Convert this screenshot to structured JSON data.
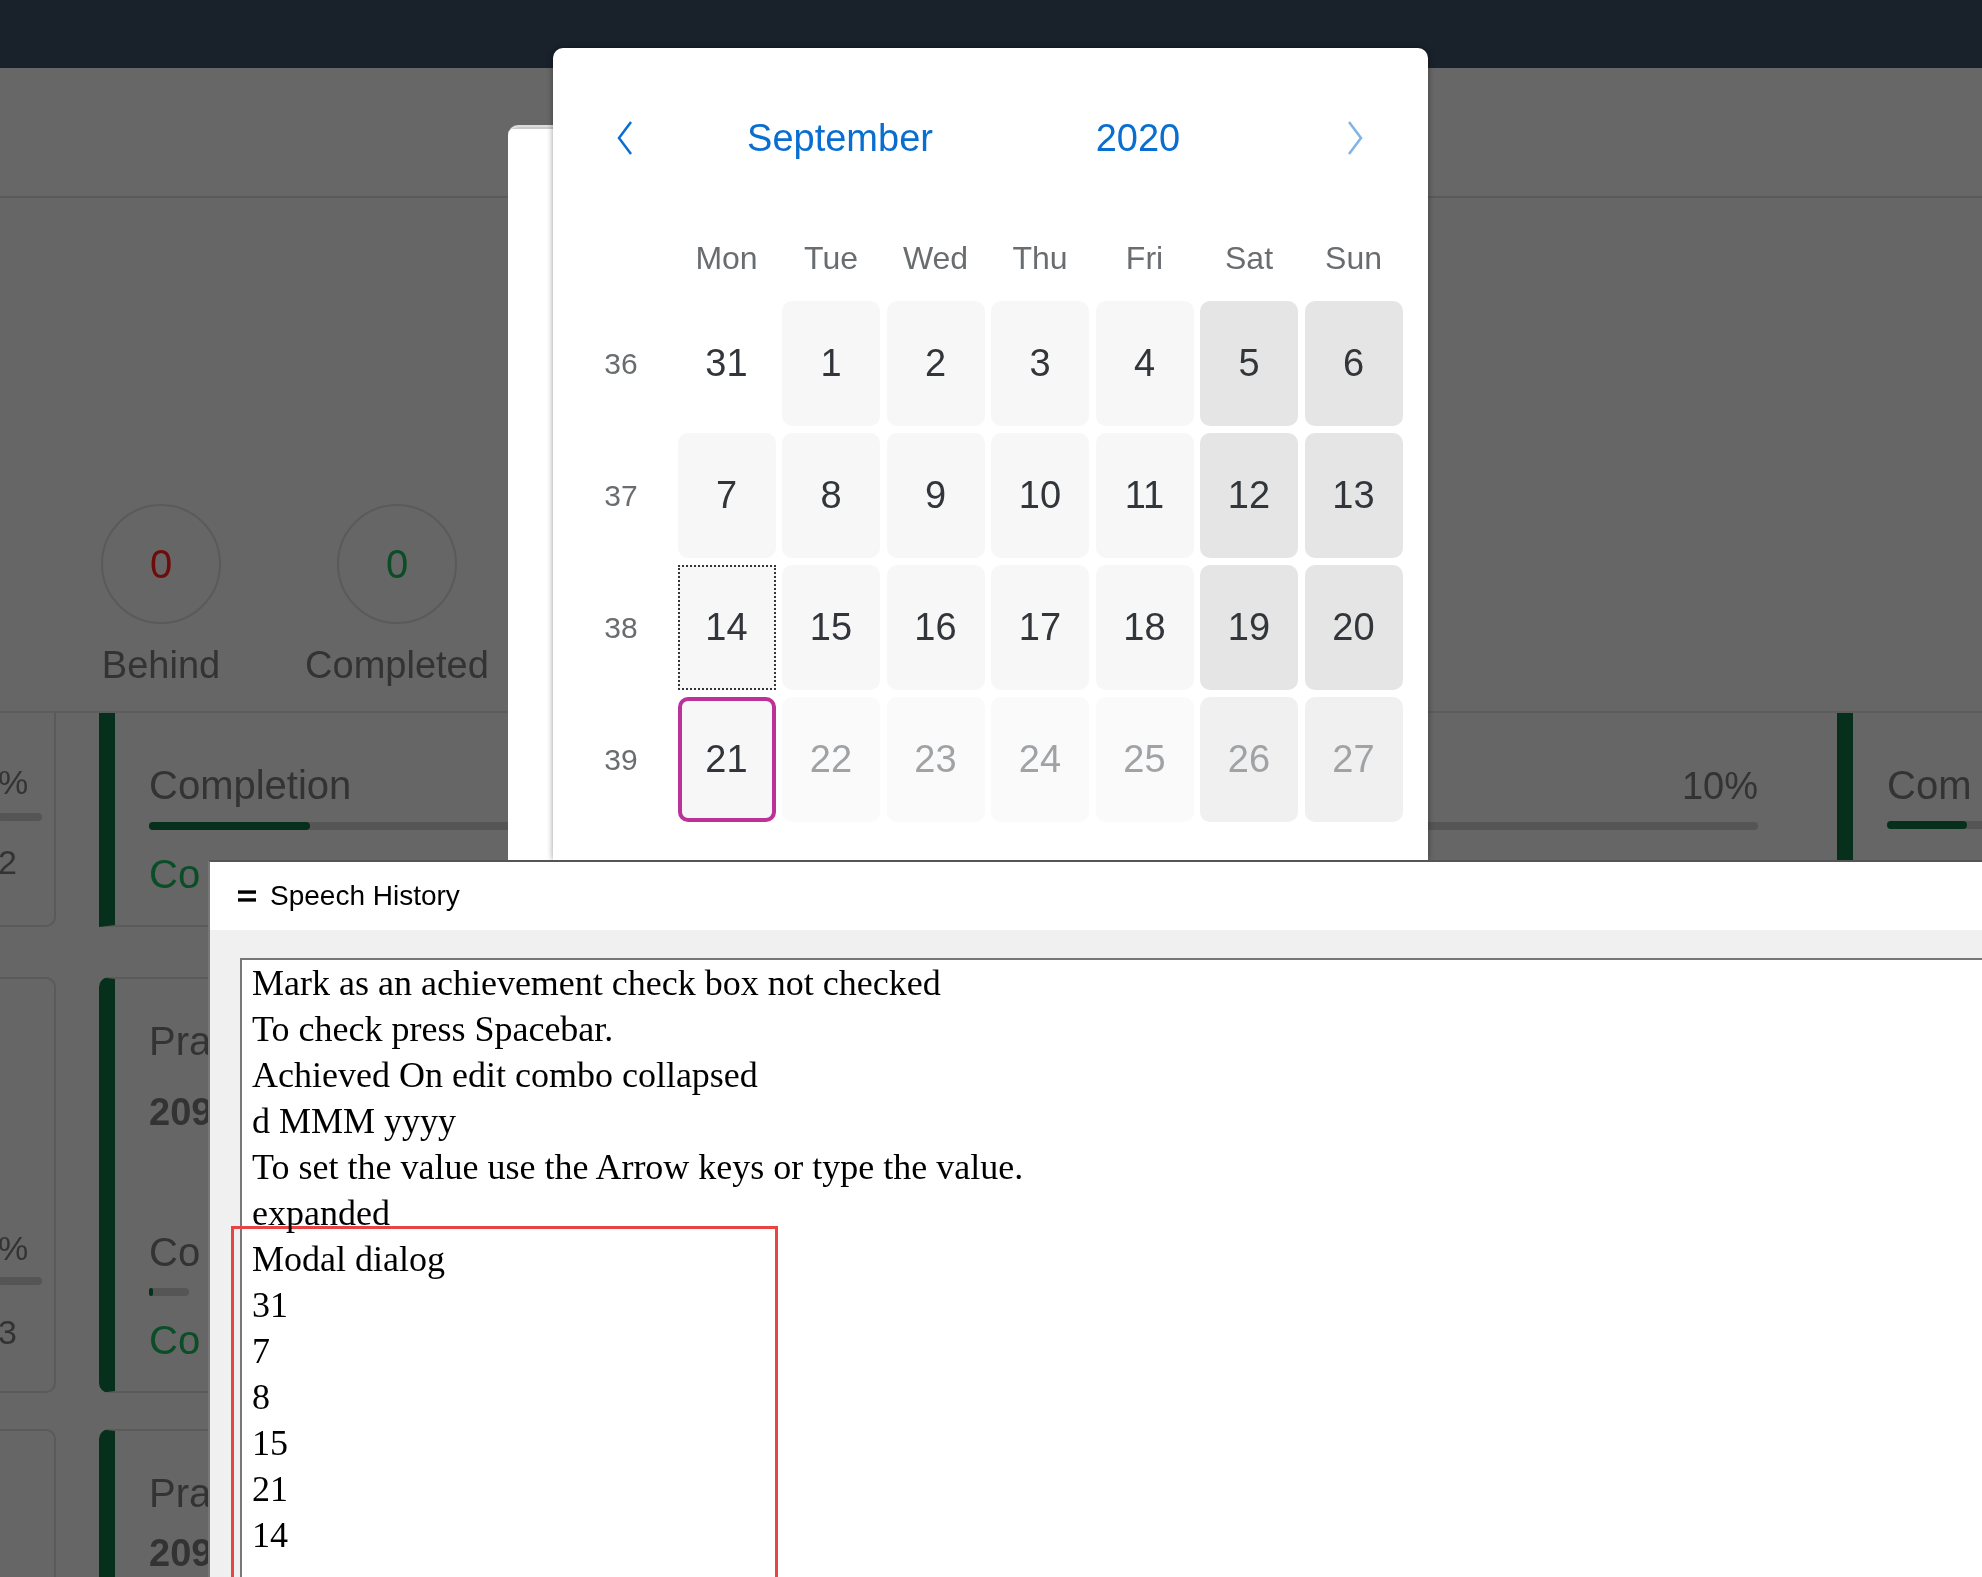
{
  "counters": [
    {
      "value": "0",
      "label": "Behind",
      "color": "#6e0b0b"
    },
    {
      "value": "0",
      "label": "Completed",
      "color": "#0b4d26"
    }
  ],
  "cards_row_1": {
    "left_stub": {
      "percent": "%",
      "count": "2"
    },
    "main": {
      "title": "Completion",
      "level": 0.1,
      "percent": "10%",
      "status": "Co"
    },
    "right_stub": {
      "title": "Com",
      "level": 0.5
    }
  },
  "cards_row_2": {
    "left_stub": {
      "percent": "%",
      "count": "3"
    },
    "main": {
      "title": "Pra",
      "number": "209",
      "label": "Co",
      "status": "Co",
      "level": 0.1
    }
  },
  "cards_row_3": {
    "main": {
      "title": "Pra",
      "number": "209"
    }
  },
  "date_picker": {
    "month": "September",
    "year": "2020",
    "weekdays": [
      "Mon",
      "Tue",
      "Wed",
      "Thu",
      "Fri",
      "Sat",
      "Sun"
    ],
    "weeks": [
      {
        "number": "36",
        "days": [
          {
            "label": "31",
            "kind": "outside",
            "muted": false,
            "focused": false,
            "selected": false
          },
          {
            "label": "1",
            "kind": "weekday",
            "muted": false,
            "focused": false,
            "selected": false
          },
          {
            "label": "2",
            "kind": "weekday",
            "muted": false,
            "focused": false,
            "selected": false
          },
          {
            "label": "3",
            "kind": "weekday",
            "muted": false,
            "focused": false,
            "selected": false
          },
          {
            "label": "4",
            "kind": "weekday",
            "muted": false,
            "focused": false,
            "selected": false
          },
          {
            "label": "5",
            "kind": "weekend",
            "muted": false,
            "focused": false,
            "selected": false
          },
          {
            "label": "6",
            "kind": "weekend",
            "muted": false,
            "focused": false,
            "selected": false
          }
        ]
      },
      {
        "number": "37",
        "days": [
          {
            "label": "7",
            "kind": "weekday",
            "muted": false,
            "focused": false,
            "selected": false
          },
          {
            "label": "8",
            "kind": "weekday",
            "muted": false,
            "focused": false,
            "selected": false
          },
          {
            "label": "9",
            "kind": "weekday",
            "muted": false,
            "focused": false,
            "selected": false
          },
          {
            "label": "10",
            "kind": "weekday",
            "muted": false,
            "focused": false,
            "selected": false
          },
          {
            "label": "11",
            "kind": "weekday",
            "muted": false,
            "focused": false,
            "selected": false
          },
          {
            "label": "12",
            "kind": "weekend",
            "muted": false,
            "focused": false,
            "selected": false
          },
          {
            "label": "13",
            "kind": "weekend",
            "muted": false,
            "focused": false,
            "selected": false
          }
        ]
      },
      {
        "number": "38",
        "days": [
          {
            "label": "14",
            "kind": "weekday",
            "muted": false,
            "focused": true,
            "selected": false
          },
          {
            "label": "15",
            "kind": "weekday",
            "muted": false,
            "focused": false,
            "selected": false
          },
          {
            "label": "16",
            "kind": "weekday",
            "muted": false,
            "focused": false,
            "selected": false
          },
          {
            "label": "17",
            "kind": "weekday",
            "muted": false,
            "focused": false,
            "selected": false
          },
          {
            "label": "18",
            "kind": "weekday",
            "muted": false,
            "focused": false,
            "selected": false
          },
          {
            "label": "19",
            "kind": "weekend",
            "muted": false,
            "focused": false,
            "selected": false
          },
          {
            "label": "20",
            "kind": "weekend",
            "muted": false,
            "focused": false,
            "selected": false
          }
        ]
      },
      {
        "number": "39",
        "days": [
          {
            "label": "21",
            "kind": "weekday",
            "muted": false,
            "focused": false,
            "selected": true
          },
          {
            "label": "22",
            "kind": "weekday",
            "muted": true,
            "focused": false,
            "selected": false
          },
          {
            "label": "23",
            "kind": "weekday",
            "muted": true,
            "focused": false,
            "selected": false
          },
          {
            "label": "24",
            "kind": "weekday",
            "muted": true,
            "focused": false,
            "selected": false
          },
          {
            "label": "25",
            "kind": "weekday",
            "muted": true,
            "focused": false,
            "selected": false
          },
          {
            "label": "26",
            "kind": "weekend",
            "muted": true,
            "focused": false,
            "selected": false
          },
          {
            "label": "27",
            "kind": "weekend",
            "muted": true,
            "focused": false,
            "selected": false
          }
        ]
      }
    ]
  },
  "speech_history": {
    "title": "Speech History",
    "lines": [
      "Mark as an achievement check box not checked",
      "To check press Spacebar.",
      "Achieved On edit combo collapsed",
      "d MMM yyyy",
      "To set the value use the Arrow keys or type the value.",
      "expanded"
    ],
    "highlighted_lines": [
      "Modal dialog",
      "31",
      "7",
      "8",
      "15",
      "21",
      "14"
    ]
  }
}
